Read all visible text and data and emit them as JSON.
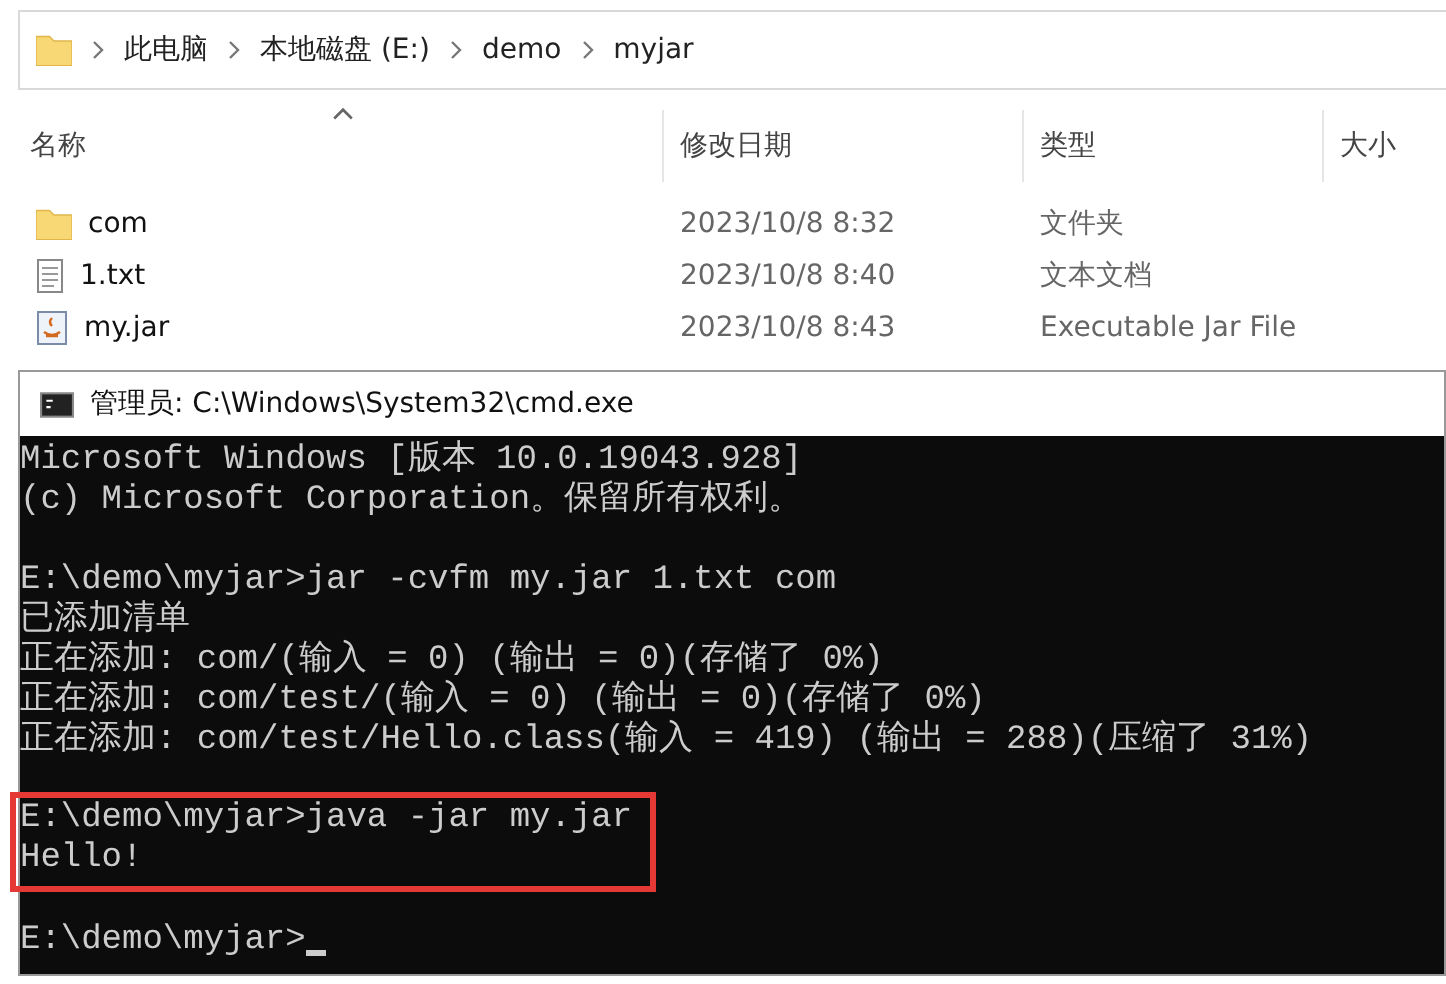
{
  "explorer": {
    "breadcrumb": [
      "此电脑",
      "本地磁盘 (E:)",
      "demo",
      "myjar"
    ],
    "columns": [
      {
        "label": "名称",
        "sorted": true
      },
      {
        "label": "修改日期",
        "sorted": false
      },
      {
        "label": "类型",
        "sorted": false
      },
      {
        "label": "大小",
        "sorted": false
      }
    ],
    "rows": [
      {
        "kind": "folder",
        "name": "com",
        "date": "2023/10/8 8:32",
        "type": "文件夹"
      },
      {
        "kind": "text",
        "name": "1.txt",
        "date": "2023/10/8 8:40",
        "type": "文本文档"
      },
      {
        "kind": "jar",
        "name": "my.jar",
        "date": "2023/10/8 8:43",
        "type": "Executable Jar File"
      }
    ]
  },
  "cmd": {
    "title": "管理员: C:\\Windows\\System32\\cmd.exe",
    "blocks": [
      {
        "highlighted": false,
        "cursor": false,
        "lines": [
          "Microsoft Windows [版本 10.0.19043.928]",
          "(c) Microsoft Corporation。保留所有权利。"
        ]
      },
      {
        "highlighted": false,
        "cursor": false,
        "lines": [
          "E:\\demo\\myjar>jar -cvfm my.jar 1.txt com",
          "已添加清单",
          "正在添加: com/(输入 = 0) (输出 = 0)(存储了 0%)",
          "正在添加: com/test/(输入 = 0) (输出 = 0)(存储了 0%)",
          "正在添加: com/test/Hello.class(输入 = 419) (输出 = 288)(压缩了 31%)"
        ]
      },
      {
        "highlighted": true,
        "cursor": false,
        "lines": [
          "E:\\demo\\myjar>java -jar my.jar",
          "Hello!"
        ]
      },
      {
        "highlighted": false,
        "cursor": true,
        "lines": [
          "E:\\demo\\myjar>"
        ]
      }
    ]
  }
}
